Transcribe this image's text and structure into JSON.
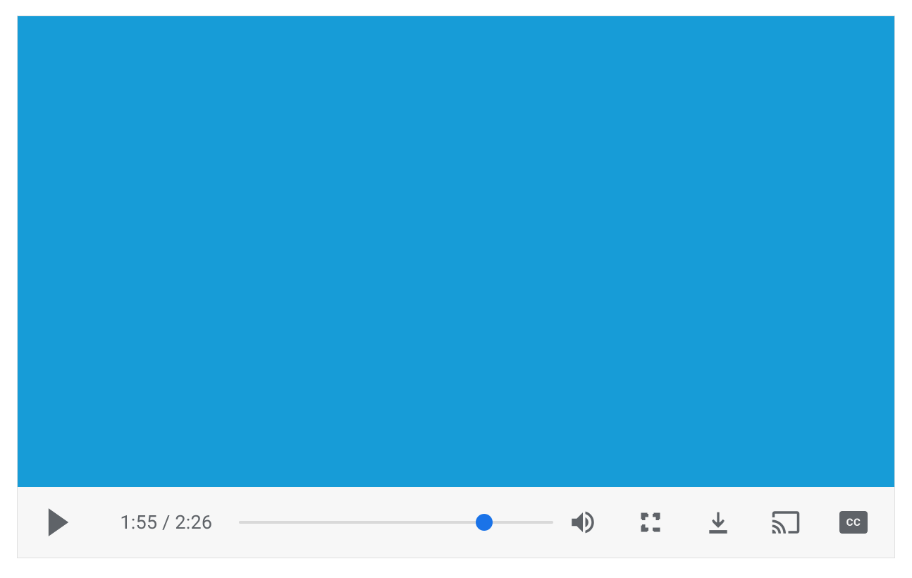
{
  "player": {
    "current_time": "1:55",
    "duration": "2:26",
    "time_separator": " / ",
    "progress_percent": 78,
    "cc_label": "CC",
    "colors": {
      "video_bg": "#179cd7",
      "controls_bg": "#f7f7f7",
      "icon": "#5f6368",
      "accent": "#1a73e8"
    },
    "icons": {
      "play": "play-icon",
      "volume": "volume-icon",
      "fullscreen": "fullscreen-icon",
      "download": "download-icon",
      "cast": "cast-icon",
      "captions": "captions-icon"
    }
  }
}
